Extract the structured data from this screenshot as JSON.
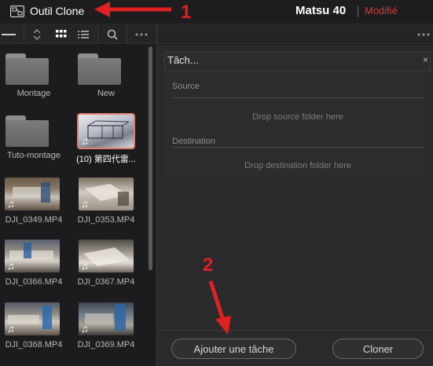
{
  "titlebar": {
    "app_title": "Outil Clone",
    "project_name": "Matsu 40",
    "status": "Modifié"
  },
  "toolbar": {
    "icons": [
      "collapse-icon",
      "sort-icon",
      "grid-view-icon",
      "list-view-icon",
      "search-icon",
      "more-icon",
      "more-icon"
    ]
  },
  "media": {
    "items": [
      {
        "type": "folder",
        "label": "Montage"
      },
      {
        "type": "folder",
        "label": "New"
      },
      {
        "type": "folder",
        "label": "Tuto-montage"
      },
      {
        "type": "clip",
        "label": "(10) 第四代雷...",
        "selected": true
      },
      {
        "type": "clip",
        "label": "DJI_0349.MP4"
      },
      {
        "type": "clip",
        "label": "DJI_0353.MP4"
      },
      {
        "type": "clip",
        "label": "DJI_0366.MP4"
      },
      {
        "type": "clip",
        "label": "DJI_0367.MP4"
      },
      {
        "type": "clip",
        "label": "DJI_0368.MP4"
      },
      {
        "type": "clip",
        "label": "DJI_0369.MP4"
      }
    ]
  },
  "task": {
    "title": "Tâch...",
    "close": "×",
    "source_label": "Source",
    "source_drop": "Drop source folder here",
    "destination_label": "Destination",
    "destination_drop": "Drop destination folder here"
  },
  "buttons": {
    "add_task": "Ajouter une tâche",
    "clone": "Cloner"
  },
  "annotations": {
    "one": "1",
    "two": "2",
    "color": "#e02020"
  }
}
